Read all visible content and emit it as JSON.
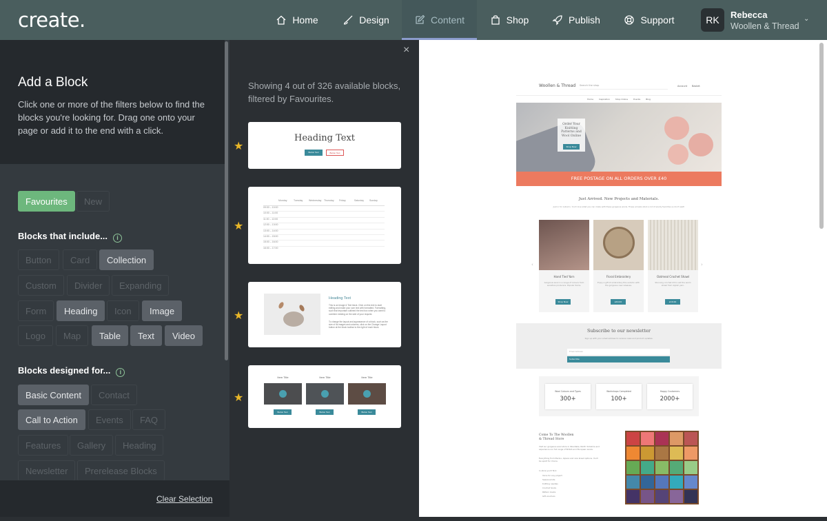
{
  "app": {
    "logo": "create."
  },
  "nav": [
    {
      "label": "Home",
      "icon": "home-icon"
    },
    {
      "label": "Design",
      "icon": "brush-icon"
    },
    {
      "label": "Content",
      "icon": "edit-icon",
      "active": true
    },
    {
      "label": "Shop",
      "icon": "bag-icon"
    },
    {
      "label": "Publish",
      "icon": "rocket-icon"
    },
    {
      "label": "Support",
      "icon": "lifebuoy-icon"
    }
  ],
  "user": {
    "initials": "RK",
    "name": "Rebecca",
    "store": "Woollen & Thread"
  },
  "panel": {
    "title": "Add a Block",
    "description": "Click one or more of the filters below to find the blocks you're looking for. Drag one onto your page or add it to the end with a click.",
    "quick_filters": [
      {
        "label": "Favourites",
        "active": true
      },
      {
        "label": "New",
        "active": false
      }
    ],
    "include_heading": "Blocks that include...",
    "include_filters": [
      {
        "label": "Button",
        "active": false
      },
      {
        "label": "Card",
        "active": false
      },
      {
        "label": "Collection",
        "active": true
      },
      {
        "label": "Custom",
        "active": false
      },
      {
        "label": "Divider",
        "active": false
      },
      {
        "label": "Expanding",
        "active": false
      },
      {
        "label": "Form",
        "active": false
      },
      {
        "label": "Heading",
        "active": true
      },
      {
        "label": "Icon",
        "active": false
      },
      {
        "label": "Image",
        "active": true
      },
      {
        "label": "Logo",
        "active": false
      },
      {
        "label": "Map",
        "active": false
      },
      {
        "label": "Table",
        "active": true
      },
      {
        "label": "Text",
        "active": true
      },
      {
        "label": "Video",
        "active": true
      }
    ],
    "designed_heading": "Blocks designed for...",
    "designed_filters": [
      {
        "label": "Basic Content",
        "active": true
      },
      {
        "label": "Contact",
        "active": false
      },
      {
        "label": "Call to Action",
        "active": true
      },
      {
        "label": "Events",
        "active": false
      },
      {
        "label": "FAQ",
        "active": false
      },
      {
        "label": "Features",
        "active": false
      },
      {
        "label": "Gallery",
        "active": false
      },
      {
        "label": "Heading",
        "active": false
      },
      {
        "label": "Newsletter",
        "active": false
      },
      {
        "label": "Prerelease Blocks",
        "active": false
      }
    ],
    "clear_label": "Clear Selection"
  },
  "results": {
    "summary": "Showing 4 out of 326 available blocks, filtered by Favourites.",
    "close_symbol": "×",
    "star": "★",
    "card1": {
      "heading": "Heading Text",
      "button1": "Button Text",
      "button2": "Button Text"
    },
    "card2": {
      "days": [
        "Monday",
        "Tuesday",
        "Wednesday",
        "Thursday",
        "Friday",
        "Saturday",
        "Sunday"
      ],
      "times": [
        "09:00 – 10:00",
        "10:00 – 11:00",
        "11:00 – 12:00",
        "12:00 – 13:00",
        "13:00 – 14:00",
        "14:00 – 15:00",
        "15:00 – 16:00",
        "16:00 – 17:00"
      ]
    },
    "card3": {
      "heading": "Heading Text",
      "body1": "This is an Image & Text block. Click on this text to start editing and make your own text with formatted. Formatting, such that important outlined the text box when you want to combine existing on the side of your request.",
      "body2": "To change the layout and appearance of a block, such as the size of its images and columns, click on the Change Layout button at the block toolbar to the right of each block."
    },
    "card4": {
      "items": [
        {
          "title": "Item Title",
          "button": "Button Text"
        },
        {
          "title": "Item Title",
          "button": "Button Text"
        },
        {
          "title": "Item Title",
          "button": "Button Text"
        }
      ]
    }
  },
  "site": {
    "brand": "Woollen & Thread",
    "search": "Search the shop",
    "account": "Account",
    "basket": "Basket",
    "menu": [
      "Home",
      "Inspiration",
      "Shop Online",
      "Events",
      "Blog"
    ],
    "hero_text": "Order Your Knitting Patterns and Wool Online",
    "hero_button": "Shop Now",
    "banner": "FREE POSTAGE ON ALL ORDERS OVER £40",
    "arrivals_title": "Just Arrived. New Projects and Materials.",
    "arrivals_sub": "Just in for Autumn. You'll love what you can make with these gorgeous wools. These arrivals stock a lot of woolly favorites so don't wait!",
    "products": [
      {
        "name": "Hand Tied Yarn",
        "desc": "Gorgeous wool in a range of colours from sensitive producers. Popular items.",
        "button": "Shop Now"
      },
      {
        "name": "Floral Embroidery",
        "desc": "Enjoy a gift of embroidery this autumn with the gorgeous new releases.",
        "button": "£40.00"
      },
      {
        "name": "Oatmeal Crochet Shawl",
        "desc": "Stunning crochet kit to suit the warm shawl from stylish yarn.",
        "button": "£16.99"
      }
    ],
    "newsletter_title": "Subscribe to our newsletter",
    "newsletter_sub": "Sign up with your email address to receive news and product updates.",
    "newsletter_placeholder": "Email Address",
    "newsletter_button": "Subscribe",
    "stats": [
      {
        "label": "Wool Colours and Types",
        "value": "300+"
      },
      {
        "label": "Workshops Completed",
        "value": "100+"
      },
      {
        "label": "Happy Customers",
        "value": "2000+"
      }
    ],
    "store_title": "Come To The Woollen & Thread Store",
    "store_text1": "Visit our gorgeous wool store in Woodlake, North Yorkshire and experience our full range of British and European wools.",
    "store_text2": "Everything from Merino, Alpaca and rare breed options. You'll be spoilt for choice.",
    "store_list_title": "In store you'll find:",
    "store_list": [
      "Yarns for any project",
      "Seasonal kits",
      "Knitting needles",
      "Crochet hooks",
      "Pattern books",
      "Gift vouchers"
    ]
  }
}
